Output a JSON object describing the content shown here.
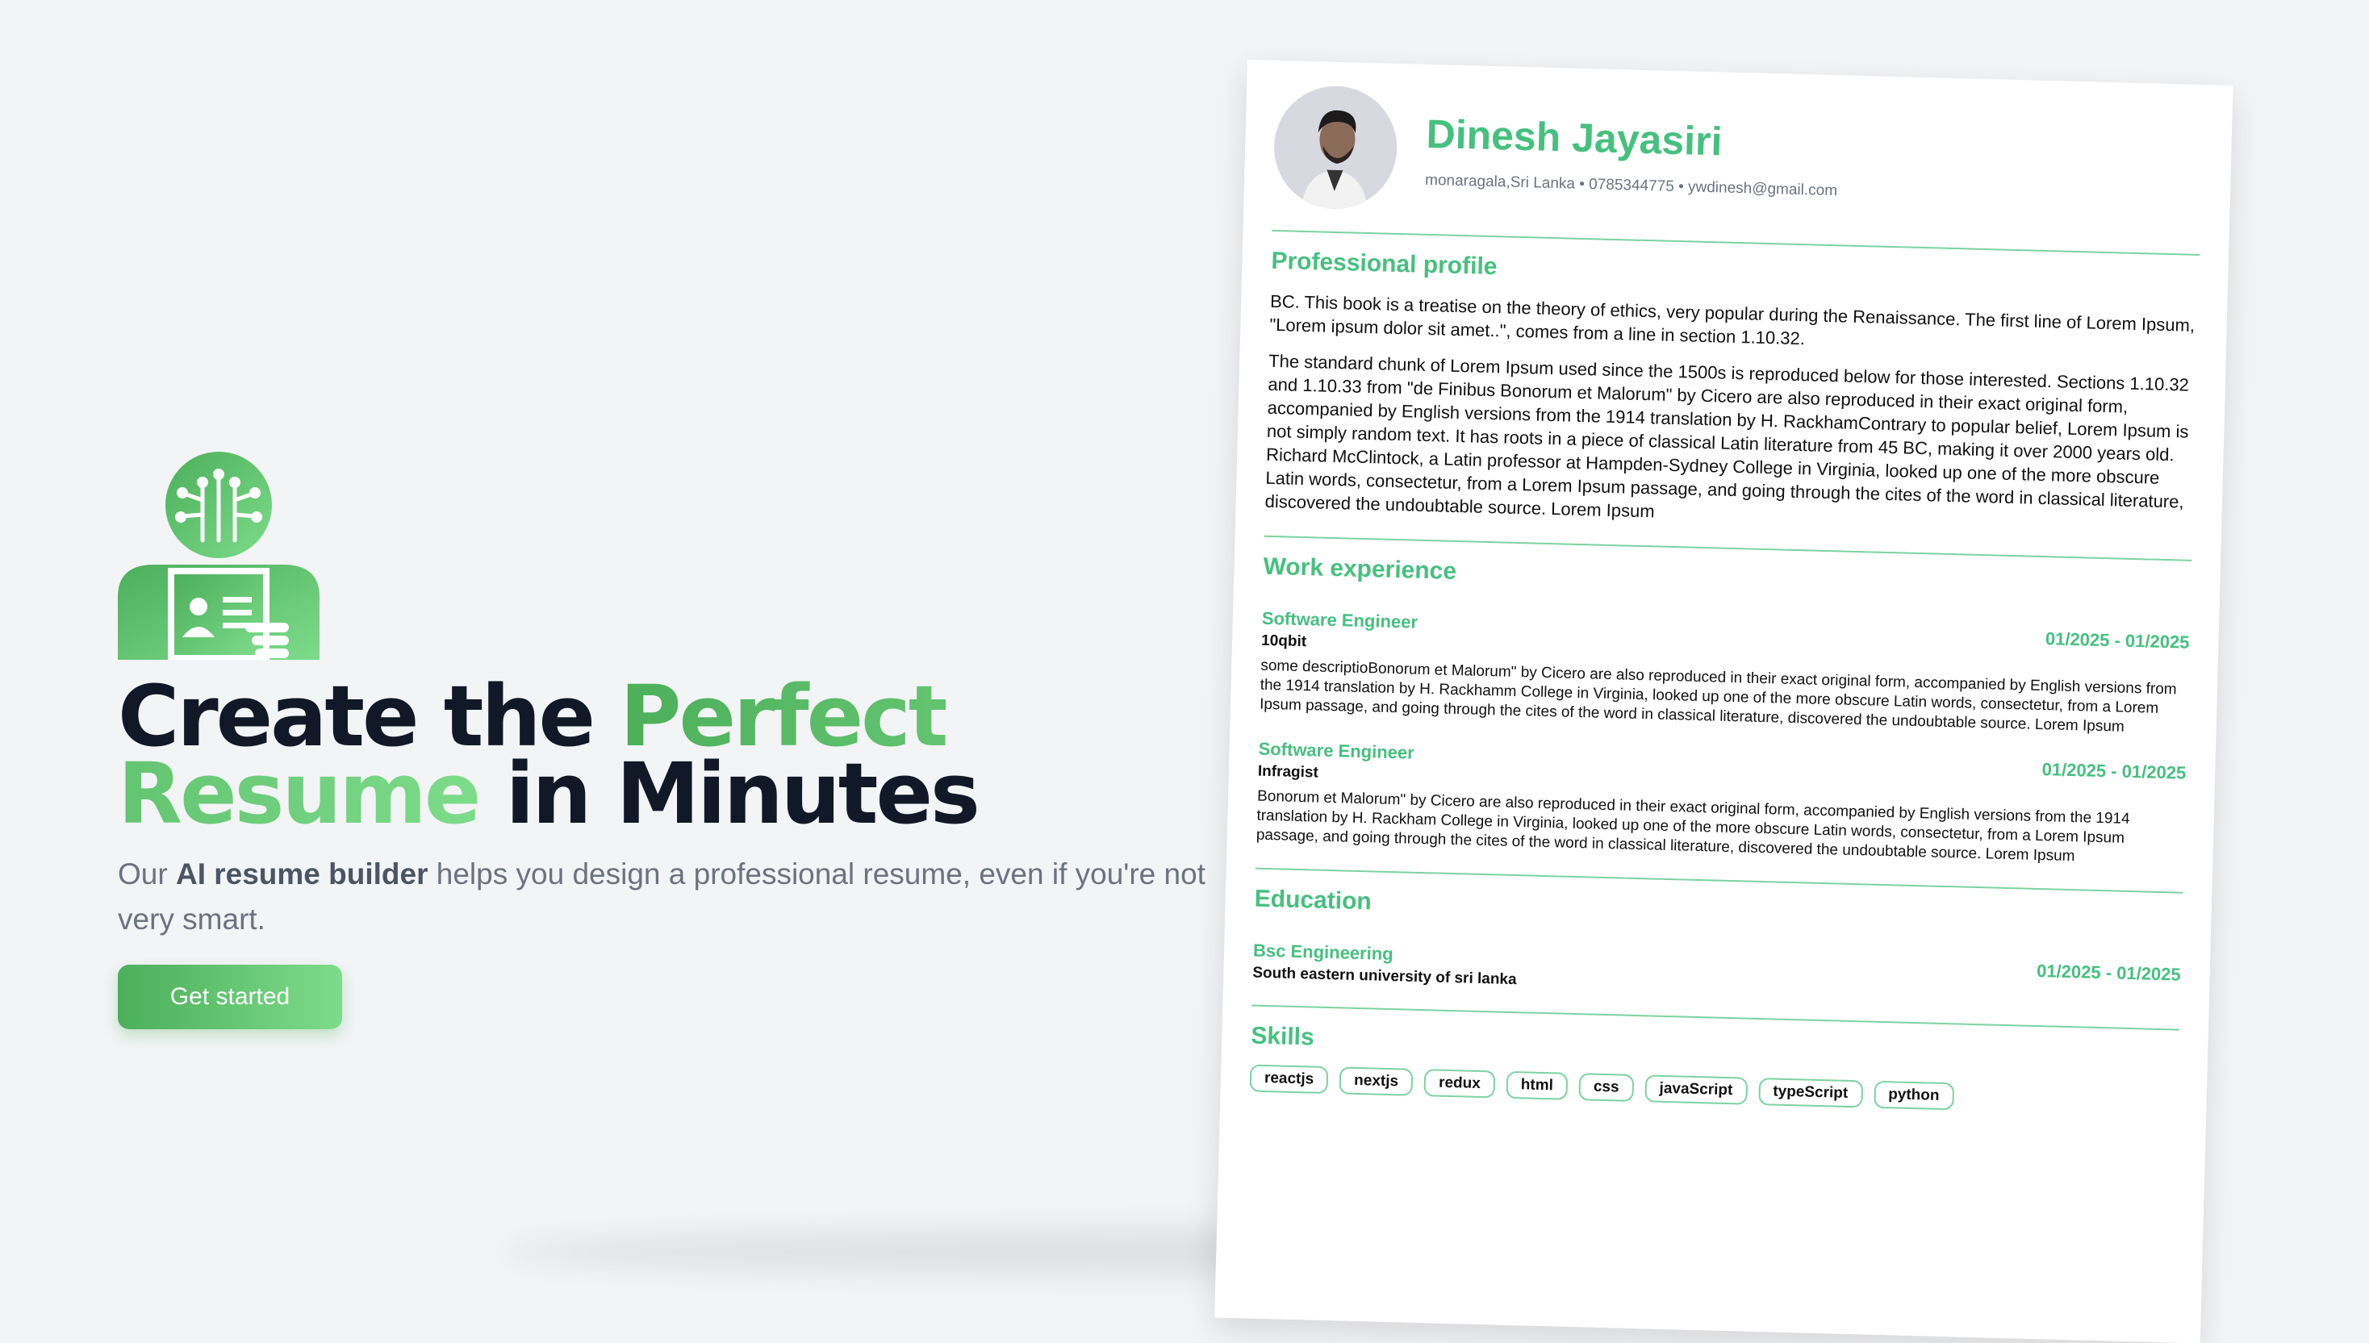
{
  "colors": {
    "accent": "#46c07e",
    "gradient_start": "#4caf5a",
    "gradient_end": "#7ddc8a",
    "heading": "#111827",
    "muted": "#6b7280",
    "page_bg": "#f3f4f6"
  },
  "hero": {
    "icon": "ai-resume-robot-icon",
    "title_before": "Create the ",
    "title_accent": "Perfect Resume",
    "title_after": " in Minutes",
    "subtitle_before": "Our ",
    "subtitle_bold": "AI resume builder",
    "subtitle_after": " helps you design a professional resume, even if you're not very smart.",
    "cta_label": "Get started"
  },
  "resume": {
    "name": "Dinesh Jayasiri",
    "contact": "monaragala,Sri Lanka • 0785344775 • ywdinesh@gmail.com",
    "profile": {
      "title": "Professional profile",
      "paragraphs": [
        "BC. This book is a treatise on the theory of ethics, very popular during the Renaissance. The first line of Lorem Ipsum, \"Lorem ipsum dolor sit amet..\", comes from a line in section 1.10.32.",
        "The standard chunk of Lorem Ipsum used since the 1500s is reproduced below for those interested. Sections 1.10.32 and 1.10.33 from \"de Finibus Bonorum et Malorum\" by Cicero are also reproduced in their exact original form, accompanied by English versions from the 1914 translation by H. RackhamContrary to popular belief, Lorem Ipsum is not simply random text. It has roots in a piece of classical Latin literature from 45 BC, making it over 2000 years old. Richard McClintock, a Latin professor at Hampden-Sydney College in Virginia, looked up one of the more obscure Latin words, consectetur, from a Lorem Ipsum passage, and going through the cites of the word in classical literature, discovered the undoubtable source. Lorem Ipsum"
      ]
    },
    "work": {
      "title": "Work experience",
      "items": [
        {
          "title": "Software Engineer",
          "company": "10qbit",
          "date": "01/2025 - 01/2025",
          "description": "some descriptioBonorum et Malorum\" by Cicero are also reproduced in their exact original form, accompanied by English versions from the 1914 translation by H. Rackhamm College in Virginia, looked up one of the more obscure Latin words, consectetur, from a Lorem Ipsum passage, and going through the cites of the word in classical literature, discovered the undoubtable source. Lorem Ipsum"
        },
        {
          "title": "Software Engineer",
          "company": "Infragist",
          "date": "01/2025 - 01/2025",
          "description": "Bonorum et Malorum\" by Cicero are also reproduced in their exact original form, accompanied by English versions from the 1914 translation by H. Rackham College in Virginia, looked up one of the more obscure Latin words, consectetur, from a Lorem Ipsum passage, and going through the cites of the word in classical literature, discovered the undoubtable source. Lorem Ipsum"
        }
      ]
    },
    "education": {
      "title": "Education",
      "items": [
        {
          "degree": "Bsc Engineering",
          "school": "South eastern university of sri lanka",
          "date": "01/2025 - 01/2025"
        }
      ]
    },
    "skills": {
      "title": "Skills",
      "items": [
        "reactjs",
        "nextjs",
        "redux",
        "html",
        "css",
        "javaScript",
        "typeScript",
        "python"
      ]
    }
  }
}
